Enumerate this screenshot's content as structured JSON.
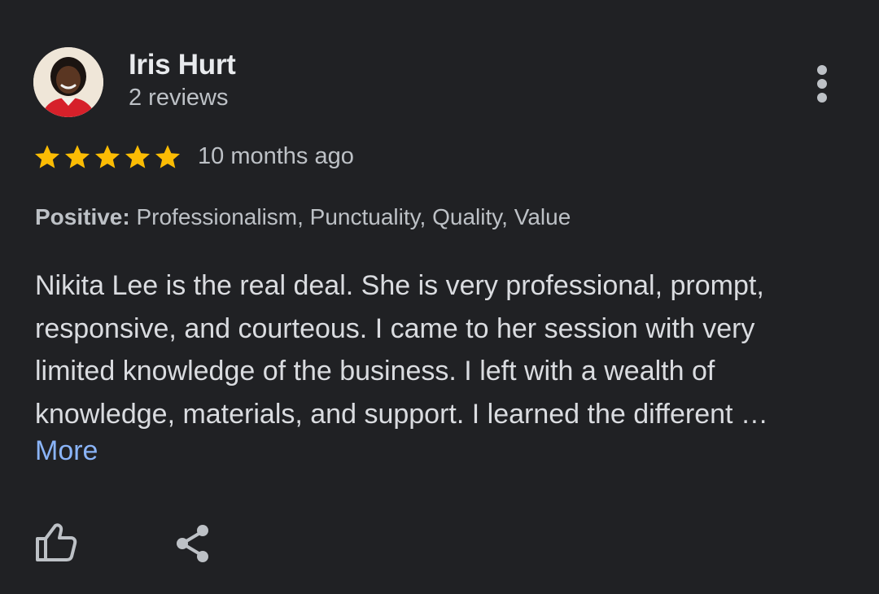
{
  "review": {
    "author": {
      "name": "Iris Hurt",
      "meta": "2 reviews"
    },
    "rating": 5,
    "rating_max": 5,
    "time_ago": "10 months ago",
    "attributes": {
      "label": "Positive:",
      "values": " Professionalism, Punctuality, Quality, Value"
    },
    "text_lines": [
      "Nikita Lee is the real deal. She is very professional, prompt,",
      "responsive, and courteous. I came to her session with very",
      "limited knowledge of the business. I left with a wealth of",
      "knowledge, materials, and support. I learned the different …"
    ],
    "more_label": "More"
  },
  "icons": {
    "menu": "more-vert-icon",
    "star": "star-icon",
    "like": "thumb-up-icon",
    "share": "share-icon"
  },
  "colors": {
    "background": "#202124",
    "star": "#fbbc04",
    "link": "#8ab4f8",
    "text_primary": "#e8eaed",
    "text_secondary": "#bdc1c6"
  }
}
